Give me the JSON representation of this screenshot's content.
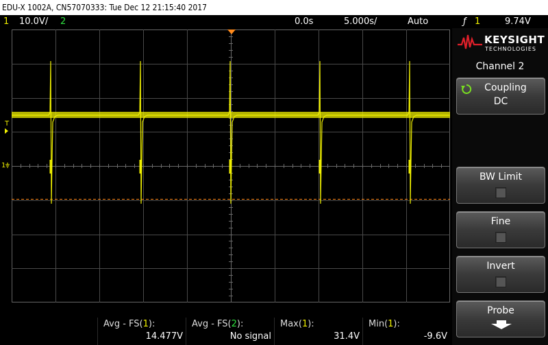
{
  "title_bar": "EDU-X 1002A, CN57070333: Tue Dec 12 21:15:40 2017",
  "status": {
    "ch1_num": "1",
    "ch1_scale": "10.0V/",
    "ch2_num": "2",
    "time_offset": "0.0s",
    "time_scale": "5.000s/",
    "trigger_mode": "Auto",
    "trigger_icon": "ƒ",
    "trigger_source": "1",
    "trigger_level": "9.74V"
  },
  "markers": {
    "trigger": "T",
    "ground": "1"
  },
  "logo": {
    "brand": "KEYSIGHT",
    "sub": "TECHNOLOGIES"
  },
  "menu": {
    "title": "Channel 2",
    "coupling_label": "Coupling",
    "coupling_value": "DC",
    "bw_limit_label": "BW Limit",
    "fine_label": "Fine",
    "invert_label": "Invert",
    "probe_label": "Probe"
  },
  "measurements": [
    {
      "label_prefix": "Avg - FS(",
      "channel": "1",
      "label_suffix": "):",
      "value": "14.477V"
    },
    {
      "label_prefix": "Avg - FS(",
      "channel": "2",
      "label_suffix": "):",
      "value": "No signal"
    },
    {
      "label_prefix": "Max(",
      "channel": "1",
      "label_suffix": "):",
      "value": "31.4V"
    },
    {
      "label_prefix": "Min(",
      "channel": "1",
      "label_suffix": "):",
      "value": "-9.6V"
    }
  ],
  "colors": {
    "ch1": "#f0f000",
    "ch2": "#30e040",
    "trigger": "#ff8a1c",
    "grid": "#4a4a4a"
  }
}
